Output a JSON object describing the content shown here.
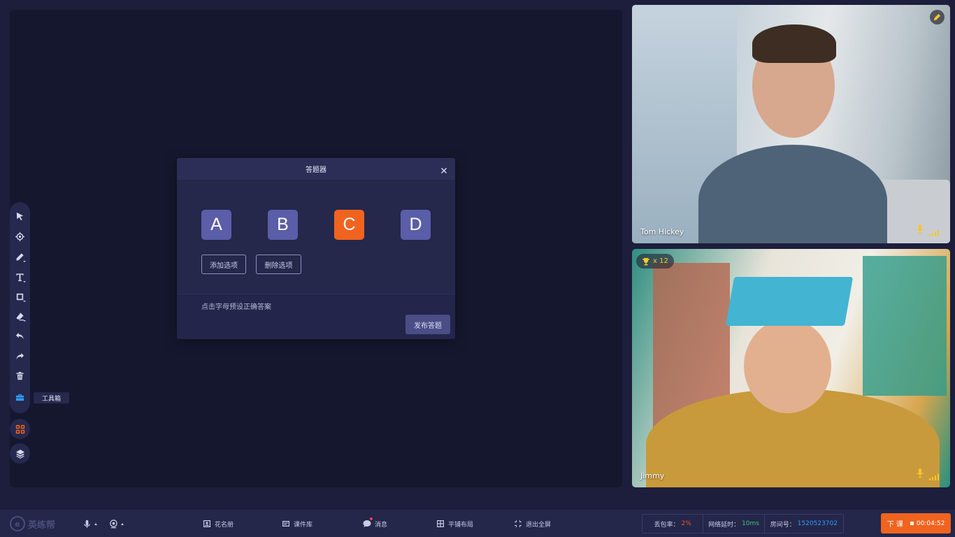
{
  "toolbar": {
    "tooltip": "工具箱",
    "tools": [
      "select-arrow-icon",
      "laser-pointer-icon",
      "pen-icon",
      "text-icon",
      "shape-icon",
      "eraser-icon",
      "undo-icon",
      "redo-icon",
      "trash-icon",
      "toolbox-icon"
    ]
  },
  "dialog": {
    "title": "答题器",
    "options": [
      "A",
      "B",
      "C",
      "D"
    ],
    "selected_option": "C",
    "add_option": "添加选项",
    "delete_option": "删除选项",
    "hint": "点击字母预设正确答案",
    "publish": "发布答题"
  },
  "videos": {
    "teacher": {
      "name": "Tom Hickey"
    },
    "student": {
      "name": "Jimmy",
      "trophy_count": "x 12"
    }
  },
  "bottombar": {
    "logo_text": "英练帮",
    "roster": "花名册",
    "courseware": "课件库",
    "messages": "消息",
    "tile_layout": "平铺布局",
    "exit_fullscreen": "退出全屏",
    "packet_loss_label": "丢包率：",
    "packet_loss_value": "2%",
    "latency_label": "网络延时：",
    "latency_value": "10ms",
    "room_label": "房间号：",
    "room_value": "1520523702",
    "end_class": "下 课",
    "timer": "00:04:52"
  },
  "colors": {
    "accent_orange": "#f0641f",
    "option_purple": "#5a5ea8",
    "active_blue": "#2f9cf5",
    "signal_yellow": "#f6c62a"
  }
}
